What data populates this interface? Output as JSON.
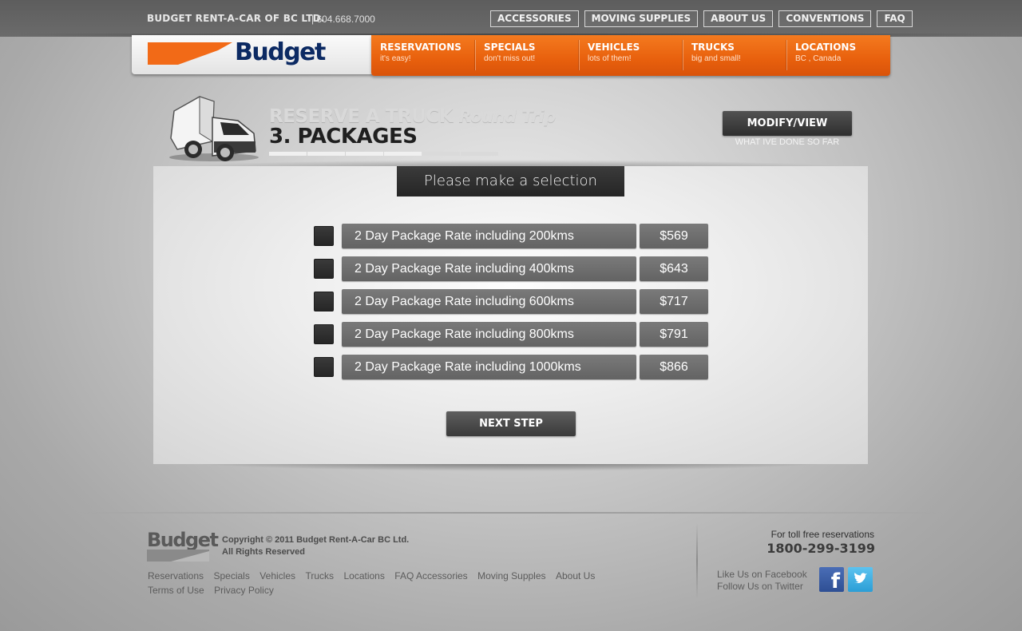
{
  "header": {
    "company": "BUDGET RENT-A-CAR OF BC LTD.",
    "phone": "| 604.668.7000",
    "top_links": [
      "ACCESSORIES",
      "MOVING SUPPLIES",
      "ABOUT US",
      "CONVENTIONS",
      "FAQ"
    ]
  },
  "logo": {
    "word": "Budget"
  },
  "nav": [
    {
      "title": "RESERVATIONS",
      "sub": "it's easy!"
    },
    {
      "title": "SPECIALS",
      "sub": "don't miss out!"
    },
    {
      "title": "VEHICLES",
      "sub": "lots of them!"
    },
    {
      "title": "TRUCKS",
      "sub": "big and small!"
    },
    {
      "title": "LOCATIONS",
      "sub": "BC , Canada"
    }
  ],
  "page": {
    "title_prefix": "RESERVE A TRUCK",
    "title_mode": "Round Trip",
    "step_title": "3. PACKAGES",
    "progress": {
      "steps_total": 6,
      "steps_done": 4
    },
    "modify_button": "MODIFY/VIEW",
    "modify_sub": "WHAT IVE DONE SO FAR"
  },
  "panel": {
    "heading": "Please make a selection",
    "options": [
      {
        "label": "2 Day Package Rate including 200kms",
        "price": "$569"
      },
      {
        "label": "2 Day Package Rate including 400kms",
        "price": "$643"
      },
      {
        "label": "2 Day Package Rate including 600kms",
        "price": "$717"
      },
      {
        "label": "2 Day Package Rate including 800kms",
        "price": "$791"
      },
      {
        "label": "2 Day Package Rate including 1000kms",
        "price": "$866"
      }
    ],
    "next_button": "NEXT STEP"
  },
  "footer": {
    "logo_word": "Budget",
    "copyright_line1": "Copyright © 2011 Budget Rent-A-Car BC Ltd.",
    "copyright_line2": "All Rights Reserved",
    "links_row1": [
      "Reservations",
      "Specials",
      "Vehicles",
      "Trucks",
      "Locations",
      "FAQ Accessories",
      "Moving Supples",
      "About Us"
    ],
    "links_row2": [
      "Terms of Use",
      "Privacy Policy"
    ],
    "toll_label": "For toll free reservations",
    "toll_number": "1800-299-3199",
    "facebook_text": "Like Us on Facebook",
    "twitter_text": "Follow Us on Twitter",
    "icons": [
      "facebook-icon",
      "twitter-icon"
    ]
  },
  "colors": {
    "brand_orange": "#f26a17",
    "brand_navy": "#0c2a63",
    "dark_button": "#2e2e2e"
  }
}
